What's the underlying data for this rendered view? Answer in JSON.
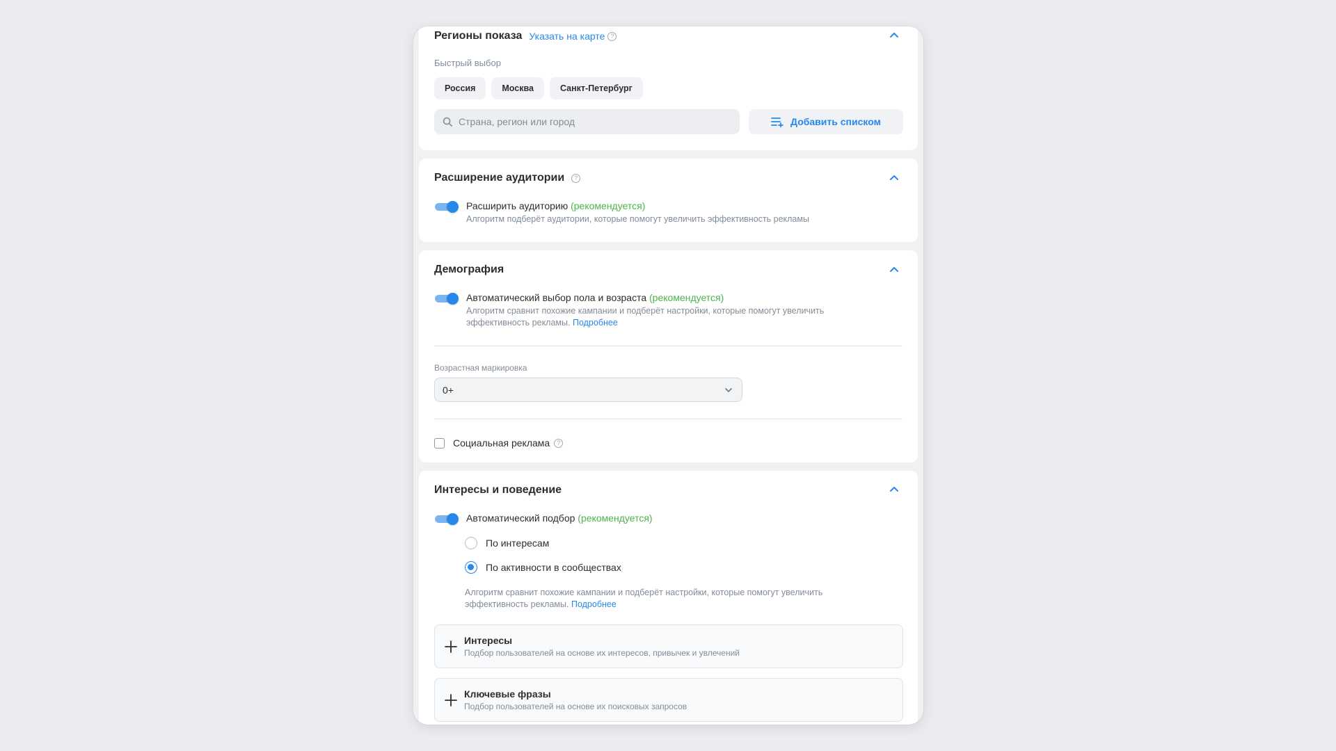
{
  "regions": {
    "title": "Регионы показа",
    "map_link": "Указать на карте",
    "help": "?",
    "quick_label": "Быстрый выбор",
    "chips": [
      "Россия",
      "Москва",
      "Санкт-Петербург"
    ],
    "search_placeholder": "Страна, регион или город",
    "add_list_label": "Добавить списком"
  },
  "audience": {
    "title": "Расширение аудитории",
    "help": "?",
    "toggle_label": "Расширить аудиторию",
    "recommended": "(рекомендуется)",
    "description": "Алгоритм подберёт аудитории, которые помогут увеличить эффективность рекламы",
    "toggle_on": true
  },
  "demography": {
    "title": "Демография",
    "toggle_label": "Автоматический выбор пола и возраста",
    "recommended": "(рекомендуется)",
    "description": "Алгоритм сравнит похожие кампании и подберёт настройки, которые помогут увеличить эффективность рекламы.",
    "more_link": "Подробнее",
    "age_label": "Возрастная маркировка",
    "age_value": "0+",
    "social_label": "Социальная реклама",
    "help": "?",
    "social_checked": false,
    "toggle_on": true
  },
  "interests": {
    "title": "Интересы и поведение",
    "toggle_label": "Автоматический подбор",
    "recommended": "(рекомендуется)",
    "radio_options": [
      "По интересам",
      "По активности в сообществах"
    ],
    "selected_radio": "По активности в сообществах",
    "description": "Алгоритм сравнит похожие кампании и подберёт настройки, которые помогут увеличить эффективность рекламы.",
    "more_link": "Подробнее",
    "add_items": [
      {
        "title": "Интересы",
        "description": "Подбор пользователей на основе их интересов, привычек и увлечений"
      },
      {
        "title": "Ключевые фразы",
        "description": "Подбор пользователей на основе их поисковых запросов"
      }
    ],
    "toggle_on": true
  },
  "colors": {
    "accent": "#2688eb",
    "recommended": "#4bb34b",
    "background": "#ebecf0"
  }
}
